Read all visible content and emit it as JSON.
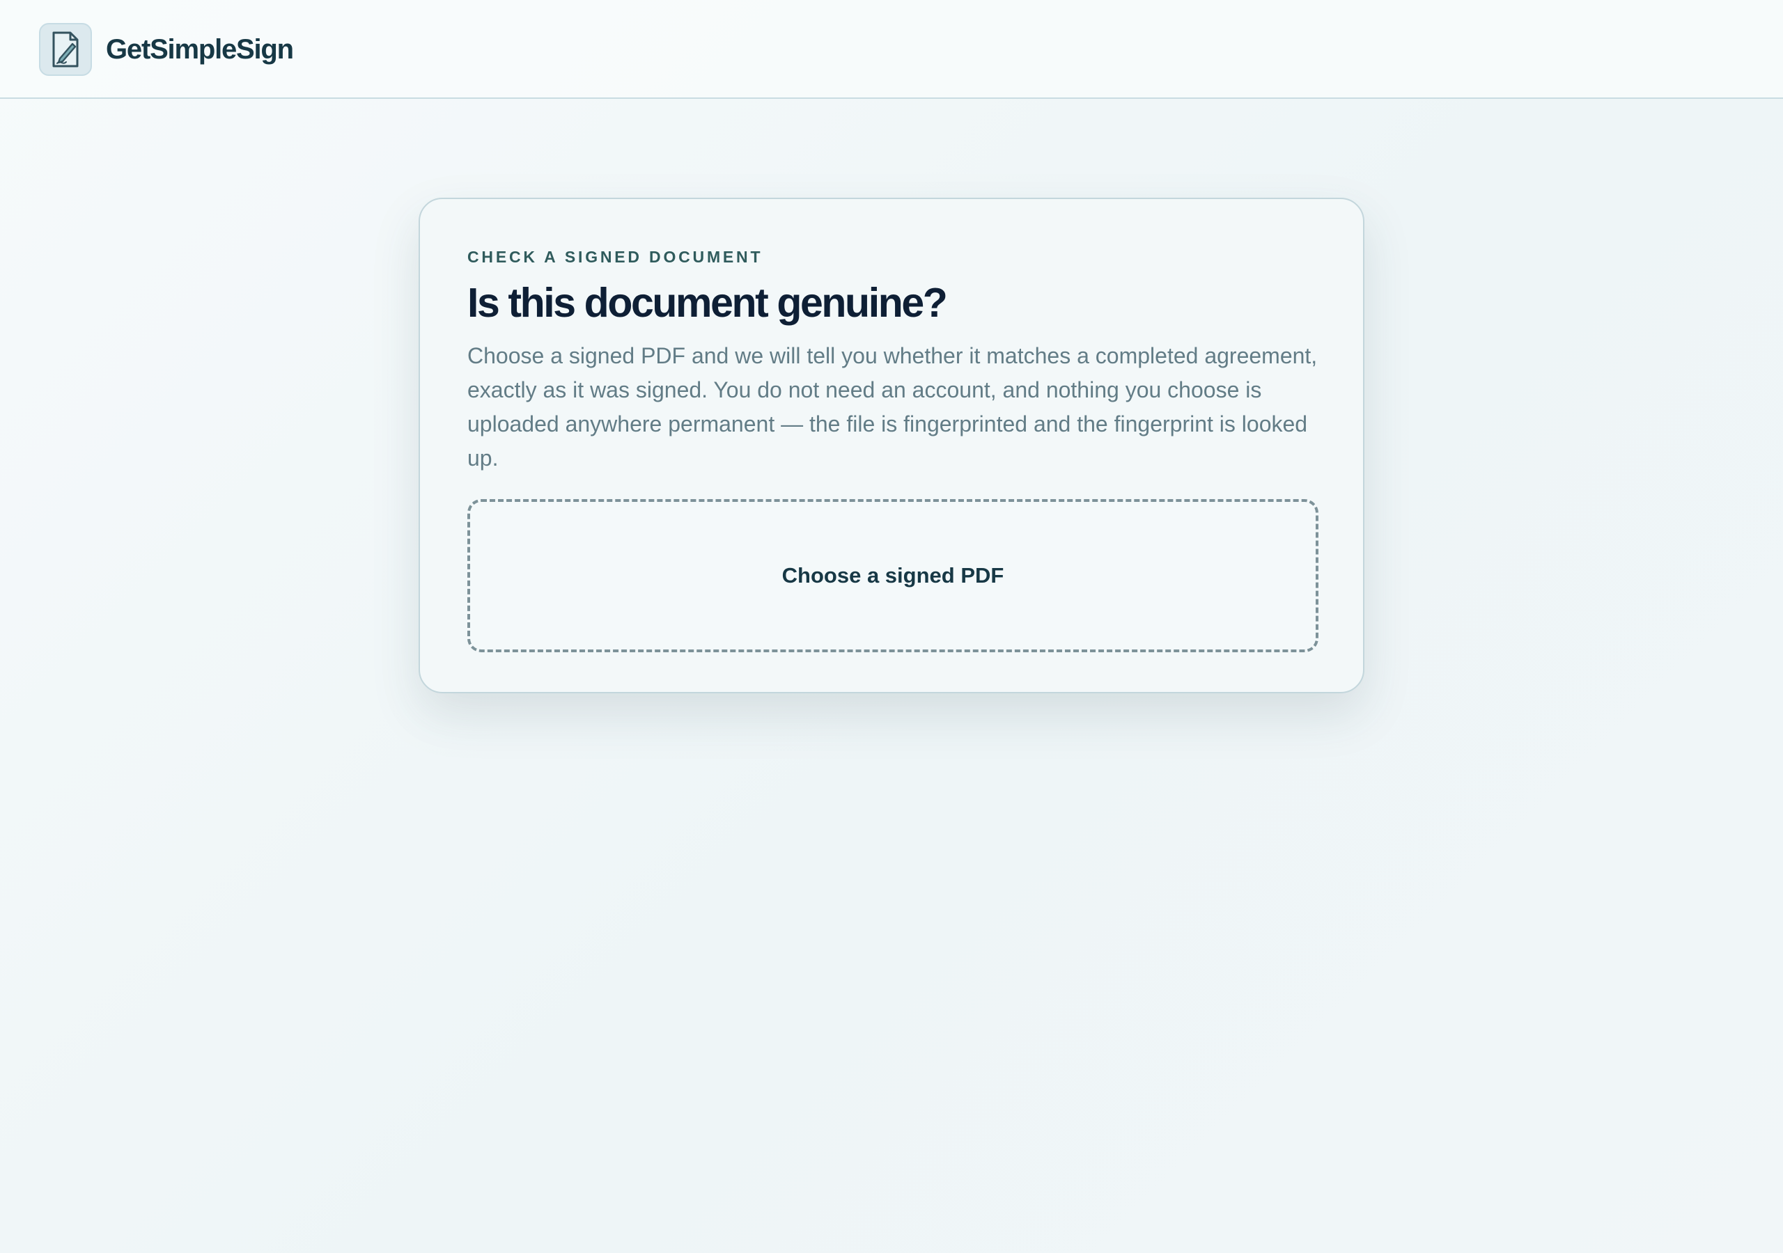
{
  "brand": {
    "name": "GetSimpleSign",
    "icon": "signed-document-pen-icon"
  },
  "verify_card": {
    "eyebrow": "CHECK A SIGNED DOCUMENT",
    "title": "Is this document genuine?",
    "description": "Choose a signed PDF and we will tell you whether it matches a completed agreement, exactly as it was signed. You do not need an account, and nothing you choose is uploaded anywhere permanent — the file is fingerprinted and the fingerprint is looked up.",
    "upload_label": "Choose a signed PDF"
  },
  "colors": {
    "accent": "#2f5b5c",
    "heading": "#0e1f35",
    "muted_text": "#627c86",
    "border": "#c3d6dc"
  }
}
